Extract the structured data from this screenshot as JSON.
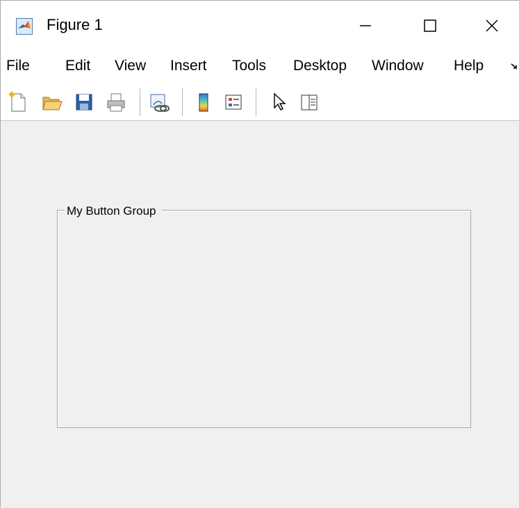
{
  "window": {
    "title": "Figure 1",
    "controls": {
      "minimize_icon": "minimize-icon",
      "maximize_icon": "maximize-icon",
      "close_icon": "close-icon"
    }
  },
  "menubar": {
    "items": [
      {
        "label": "File"
      },
      {
        "label": "Edit"
      },
      {
        "label": "View"
      },
      {
        "label": "Insert"
      },
      {
        "label": "Tools"
      },
      {
        "label": "Desktop"
      },
      {
        "label": "Window"
      },
      {
        "label": "Help"
      }
    ],
    "overflow_icon": "menu-overflow-icon"
  },
  "toolbar": {
    "buttons": [
      {
        "icon": "new-figure-icon"
      },
      {
        "icon": "open-file-icon"
      },
      {
        "icon": "save-figure-icon"
      },
      {
        "icon": "print-figure-icon"
      },
      {
        "icon": "link-plot-icon"
      },
      {
        "icon": "insert-colorbar-icon"
      },
      {
        "icon": "insert-legend-icon"
      },
      {
        "icon": "edit-plot-pointer-icon"
      },
      {
        "icon": "open-property-inspector-icon"
      }
    ]
  },
  "content": {
    "button_group": {
      "title": "My Button Group"
    }
  },
  "colors": {
    "window_bg": "#f0f0f0",
    "bar_bg": "#ffffff",
    "panel_border": "#a8a8a8"
  }
}
